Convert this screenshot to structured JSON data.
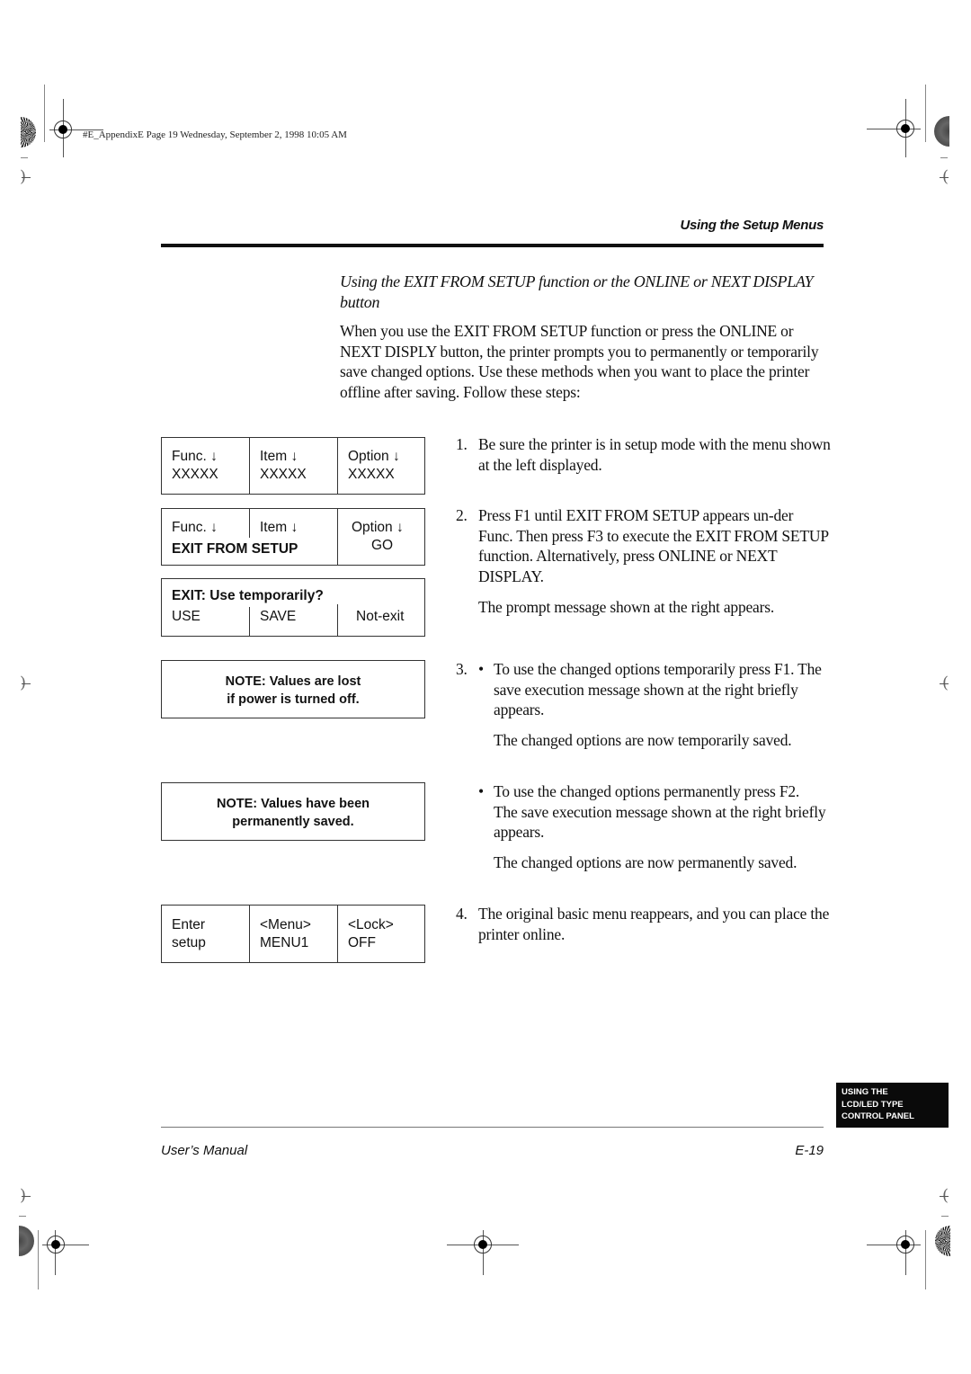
{
  "slug": "#E_AppendixE  Page 19  Wednesday, September 2, 1998  10:05 AM",
  "running_head": "Using the Setup Menus",
  "section_title": "Using the EXIT FROM SETUP function or the ONLINE or NEXT DISPLAY button",
  "intro": "When you use the EXIT FROM SETUP function or press the ONLINE or NEXT DISPLY button, the printer prompts you to permanently or temporarily save changed options. Use these methods when you want to place the printer offline after saving. Follow these steps:",
  "steps": [
    {
      "num": "1.",
      "text": "Be sure the printer is in setup mode with the menu shown at the left displayed."
    },
    {
      "num": "2.",
      "text": "Press F1 until EXIT FROM SETUP appears un-der Func. Then press F3 to execute the EXIT FROM SETUP function. Alternatively, press ONLINE or NEXT DISPLAY.",
      "followup": "The prompt message shown at the right appears."
    },
    {
      "num": "3.",
      "bullets": [
        {
          "bullet": "•",
          "text": "To use the changed options temporarily press F1. The save execution message shown at the right briefly appears.",
          "followup": "The changed options are now temporarily saved."
        },
        {
          "bullet": "•",
          "text": "To use the changed options permanently press F2. The save execution message shown at the right briefly appears.",
          "followup": "The changed options are now permanently saved."
        }
      ]
    },
    {
      "num": "4.",
      "text": "The original basic menu reappears, and you can place the printer online."
    }
  ],
  "lcd_displays": {
    "menu": {
      "func": "Func. ↓",
      "item": "Item ↓",
      "option": "Option ↓",
      "func_val": "XXXXX",
      "item_val": "XXXXX",
      "option_val": "XXXXX"
    },
    "exit_setup": {
      "func": "Func. ↓",
      "item": "Item ↓",
      "option": "Option ↓",
      "func_val": "EXIT FROM SETUP",
      "option_val": "GO"
    },
    "prompt": {
      "title": "EXIT: Use temporarily?",
      "opt1": "USE",
      "opt2": "SAVE",
      "opt3": "Not-exit"
    },
    "note_temp": {
      "line1": "NOTE: Values are lost",
      "line2": "if power is turned off."
    },
    "note_perm": {
      "line1": "NOTE: Values have been",
      "line2": "permanently saved."
    },
    "basic": {
      "c1_l1": "Enter",
      "c1_l2": "setup",
      "c2_l1": "<Menu>",
      "c2_l2": "MENU1",
      "c3_l1": "<Lock>",
      "c3_l2": "OFF"
    }
  },
  "side_tab": {
    "line1": "USING THE",
    "line2": "LCD/LED TYPE",
    "line3": "CONTROL PANEL"
  },
  "footer": {
    "left": "User’s Manual",
    "right": "E-19"
  }
}
